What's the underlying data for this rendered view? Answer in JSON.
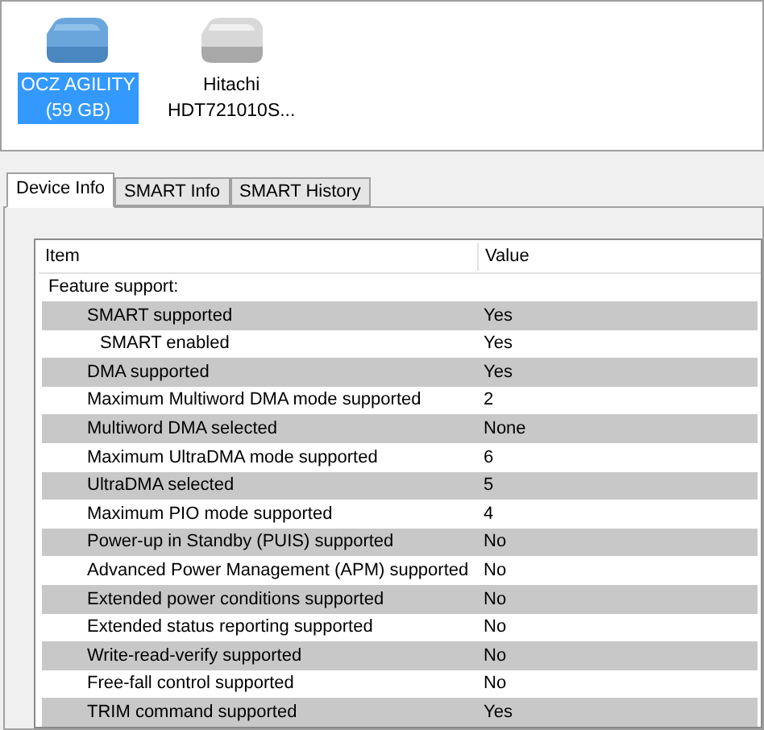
{
  "drives": [
    {
      "label": "OCZ AGILITY",
      "sublabel": "(59 GB)",
      "kind": "ssd",
      "selected": true
    },
    {
      "label": "Hitachi",
      "sublabel": "HDT721010S...",
      "kind": "hdd",
      "selected": false
    }
  ],
  "tabs": [
    {
      "label": "Device Info",
      "selected": true
    },
    {
      "label": "SMART Info",
      "selected": false
    },
    {
      "label": "SMART History",
      "selected": false
    }
  ],
  "table": {
    "columns": [
      "Item",
      "Value"
    ],
    "rows": [
      {
        "item": "Feature support:",
        "children": [
          {
            "item": "SMART supported",
            "value": "Yes",
            "children": [
              {
                "item": "SMART enabled",
                "value": "Yes"
              }
            ]
          },
          {
            "item": "DMA supported",
            "value": "Yes"
          },
          {
            "item": "Maximum Multiword DMA mode supported",
            "value": "2"
          },
          {
            "item": "Multiword DMA selected",
            "value": "None"
          },
          {
            "item": "Maximum UltraDMA mode supported",
            "value": "6"
          },
          {
            "item": "UltraDMA selected",
            "value": "5"
          },
          {
            "item": "Maximum PIO mode supported",
            "value": "4"
          },
          {
            "item": "Power-up in Standby (PUIS) supported",
            "value": "No"
          },
          {
            "item": "Advanced Power Management (APM) supported",
            "value": "No"
          },
          {
            "item": "Extended power conditions supported",
            "value": "No"
          },
          {
            "item": "Extended status reporting supported",
            "value": "No"
          },
          {
            "item": "Write-read-verify supported",
            "value": "No"
          },
          {
            "item": "Free-fall control supported",
            "value": "No"
          },
          {
            "item": "TRIM command supported",
            "value": "Yes"
          }
        ]
      }
    ]
  }
}
